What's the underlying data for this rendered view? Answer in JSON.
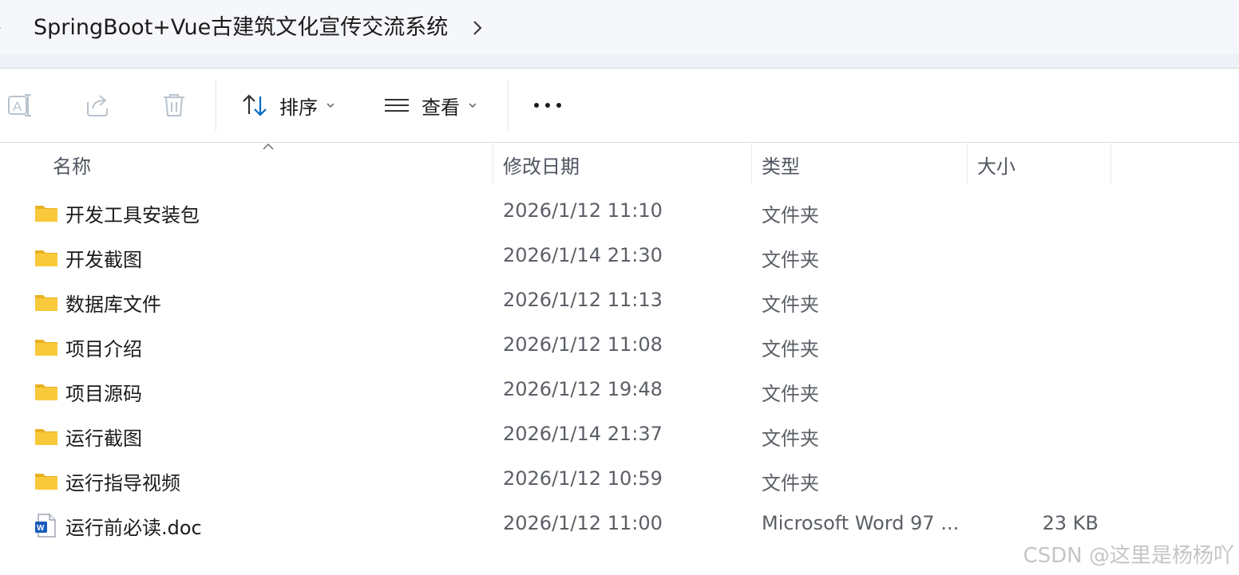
{
  "breadcrumb": {
    "folder": "SpringBoot+Vue古建筑文化宣传交流系统"
  },
  "toolbar": {
    "sort_label": "排序",
    "view_label": "查看",
    "more_label": "..."
  },
  "columns": {
    "name": "名称",
    "modified": "修改日期",
    "type": "类型",
    "size": "大小"
  },
  "files": [
    {
      "name": "开发工具安装包",
      "date": "2026/1/12 11:10",
      "type": "文件夹",
      "size": "",
      "icon": "folder-icon"
    },
    {
      "name": "开发截图",
      "date": "2026/1/14 21:30",
      "type": "文件夹",
      "size": "",
      "icon": "folder-icon"
    },
    {
      "name": "数据库文件",
      "date": "2026/1/12 11:13",
      "type": "文件夹",
      "size": "",
      "icon": "folder-icon"
    },
    {
      "name": "项目介绍",
      "date": "2026/1/12 11:08",
      "type": "文件夹",
      "size": "",
      "icon": "folder-icon"
    },
    {
      "name": "项目源码",
      "date": "2026/1/12 19:48",
      "type": "文件夹",
      "size": "",
      "icon": "folder-icon"
    },
    {
      "name": "运行截图",
      "date": "2026/1/14 21:37",
      "type": "文件夹",
      "size": "",
      "icon": "folder-icon"
    },
    {
      "name": "运行指导视频",
      "date": "2026/1/12 10:59",
      "type": "文件夹",
      "size": "",
      "icon": "folder-icon"
    },
    {
      "name": "运行前必读.doc",
      "date": "2026/1/12 11:00",
      "type": "Microsoft Word 97 ...",
      "size": "23 KB",
      "icon": "word-doc-icon"
    }
  ],
  "watermark": "CSDN @这里是杨杨吖",
  "colors": {
    "folder": "#f8c93a",
    "folder_dark": "#e9b021",
    "accent": "#0067c0"
  }
}
